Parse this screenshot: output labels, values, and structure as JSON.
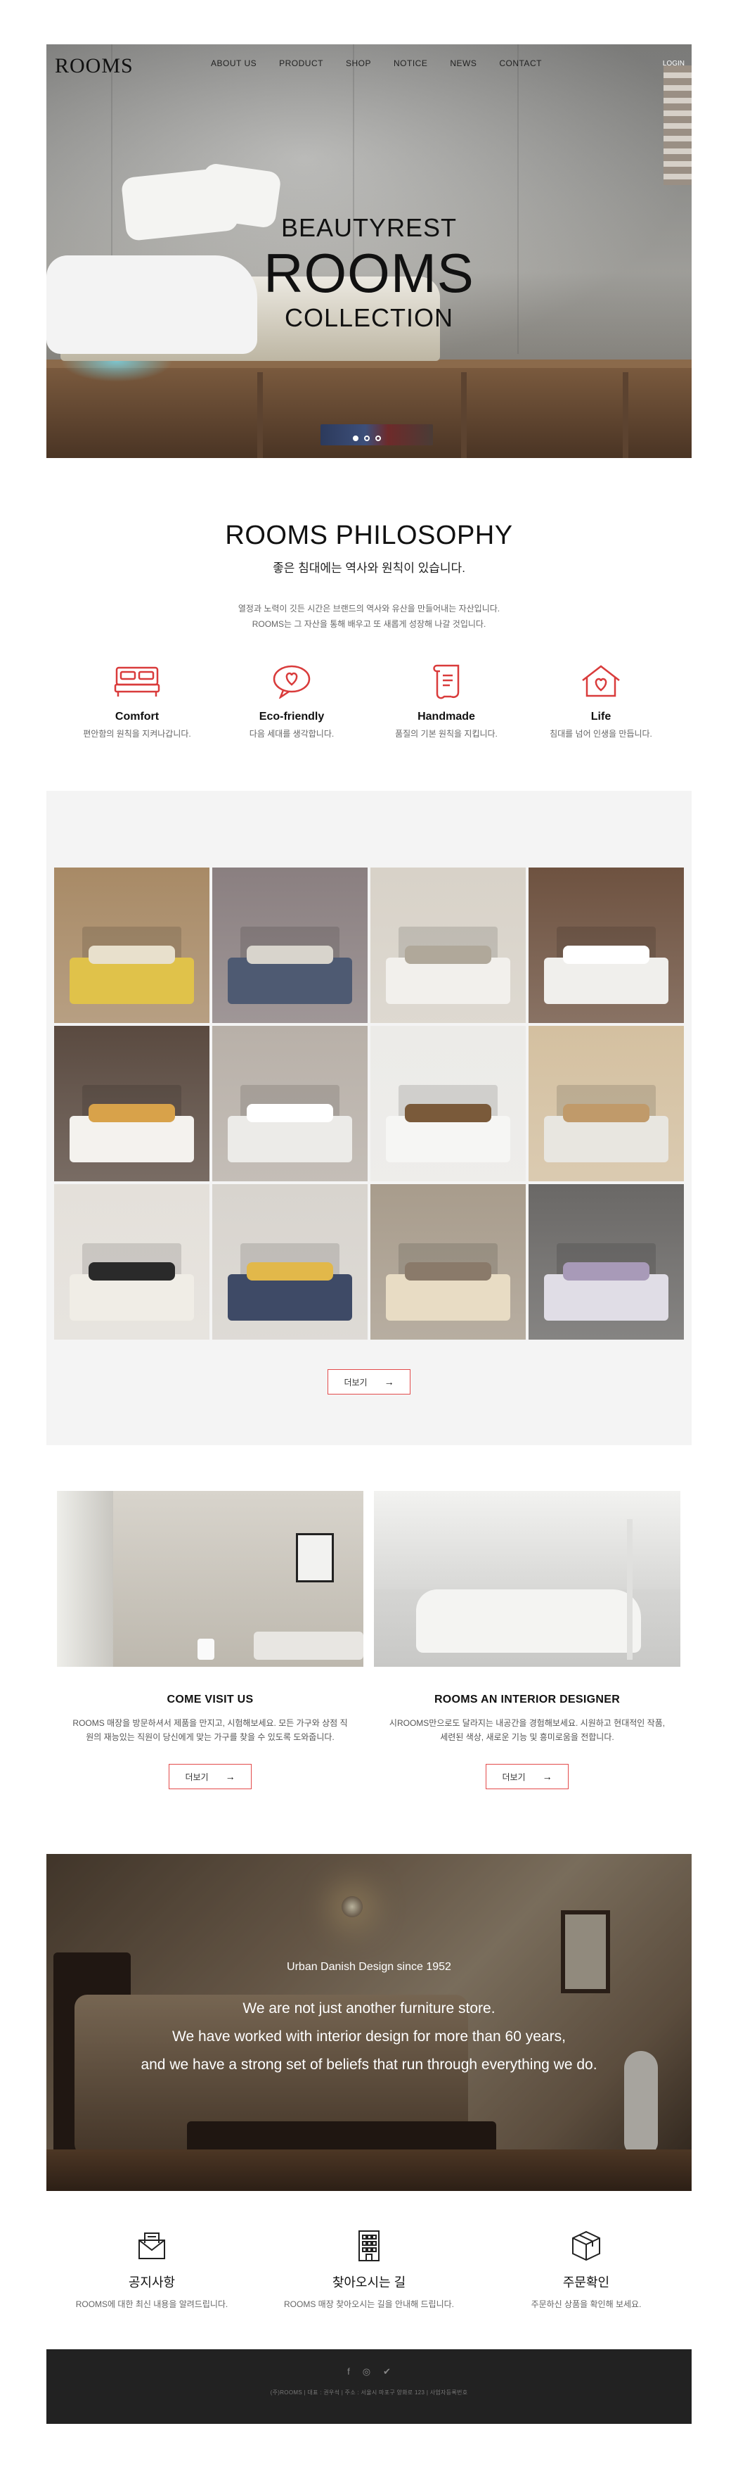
{
  "brand": {
    "logo": "ROOMS"
  },
  "nav": {
    "items": [
      "ABOUT US",
      "PRODUCT",
      "SHOP",
      "NOTICE",
      "NEWS",
      "CONTACT"
    ],
    "login": "LOGIN"
  },
  "hero": {
    "line1": "BEAUTYREST",
    "line2": "ROOMS",
    "line3": "COLLECTION",
    "slide_count": 3,
    "active_slide": 1
  },
  "philosophy": {
    "title": "ROOMS PHILOSOPHY",
    "subtitle": "좋은 침대에는 역사와 원칙이 있습니다.",
    "desc_line1": "열정과 노력이 깃든 시간은 브랜드의 역사와 유산을 만들어내는 자산입니다.",
    "desc_line2": "ROOMS는 그 자산을 통해 배우고 또 새롭게 성장해 나갈 것입니다.",
    "features": [
      {
        "icon": "bed-icon",
        "title": "Comfort",
        "desc": "편안함의 원칙을 지켜나갑니다."
      },
      {
        "icon": "heart-chat-icon",
        "title": "Eco-friendly",
        "desc": "다음 세대를 생각합니다."
      },
      {
        "icon": "scroll-icon",
        "title": "Handmade",
        "desc": "품질의 기본 원칙을 지킵니다."
      },
      {
        "icon": "home-heart-icon",
        "title": "Life",
        "desc": "침대를 넘어 인생을 만듭니다."
      }
    ],
    "accent": "#d93b3b"
  },
  "gallery": {
    "more_label": "더보기",
    "tiles": [
      {
        "bg": "#a88a66",
        "bed": "#e0c24a",
        "pil": "#e8e0cc"
      },
      {
        "bg": "#8a7f80",
        "bed": "#4e5a72",
        "pil": "#d8d4cc"
      },
      {
        "bg": "#d8d2c8",
        "bed": "#f2f0ec",
        "pil": "#b0a89a"
      },
      {
        "bg": "#6e5240",
        "bed": "#f0efec",
        "pil": "#ffffff"
      },
      {
        "bg": "#5a4a40",
        "bed": "#f4f2ee",
        "pil": "#d8a24a"
      },
      {
        "bg": "#b8b0a8",
        "bed": "#ecebe8",
        "pil": "#ffffff"
      },
      {
        "bg": "#ecebe8",
        "bed": "#f6f6f4",
        "pil": "#7a5a3a"
      },
      {
        "bg": "#d4c0a0",
        "bed": "#e8e6e0",
        "pil": "#c09a6a"
      },
      {
        "bg": "#e4e0da",
        "bed": "#f0ede6",
        "pil": "#2a2a2a"
      },
      {
        "bg": "#d8d4ce",
        "bed": "#3e4a66",
        "pil": "#e2b84a"
      },
      {
        "bg": "#a89c8c",
        "bed": "#e8dcc4",
        "pil": "#8a7a6a"
      },
      {
        "bg": "#6a6866",
        "bed": "#e0dde6",
        "pil": "#a89ab8"
      }
    ]
  },
  "visit": [
    {
      "title": "COME VISIT US",
      "desc": "ROOMS 매장을 방문하셔서 제품을 만지고, 시험해보세요. 모든 가구와 상점 직원의 재능있는 직원이 당신에게 맞는 가구를 찾을 수 있도록 도와줍니다.",
      "more_label": "더보기",
      "img_bg": "#cfcac2"
    },
    {
      "title": "ROOMS AN INTERIOR DESIGNER",
      "desc": "시ROOMS만으로도 달라지는 내공간을 경험해보세요. 시원하고 현대적인 작품, 세련된 색상, 새로운 기능 및 흥미로움을 전합니다.",
      "more_label": "더보기",
      "img_bg": "#d8d8d6"
    }
  ],
  "danish": {
    "tagline": "Urban Danish Design since 1952",
    "line1": "We are not just another furniture store.",
    "line2": "We have worked with interior design for more than 60 years,",
    "line3": "and we have a strong set of beliefs that run through everything we do."
  },
  "info": [
    {
      "icon": "mail-icon",
      "title": "공지사항",
      "desc": "ROOMS에 대한 최신 내용을 알려드립니다."
    },
    {
      "icon": "building-icon",
      "title": "찾아오시는 길",
      "desc": "ROOMS 매장 찾아오시는 길을 안내해 드립니다."
    },
    {
      "icon": "box-icon",
      "title": "주문확인",
      "desc": "주문하신 상품을 확인해 보세요."
    }
  ],
  "footer": {
    "social": [
      "f",
      "◎",
      "✔"
    ],
    "info": "(주)ROOMS | 대표 : 권우석 | 주소 : 서울시 마포구 양화로 123 | 사업자등록번호"
  }
}
